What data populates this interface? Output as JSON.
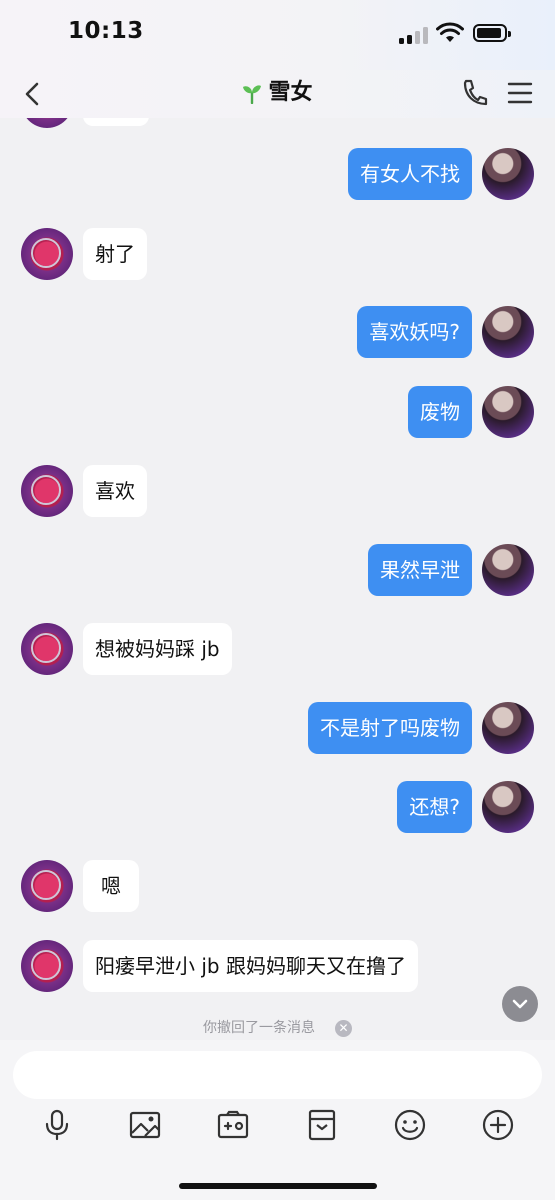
{
  "status_bar": {
    "time": "10:13"
  },
  "header": {
    "title": "雪女"
  },
  "messages": [
    {
      "side": "right",
      "text": "有女人不找"
    },
    {
      "side": "left",
      "text": "射了"
    },
    {
      "side": "right",
      "text": "喜欢妖吗?"
    },
    {
      "side": "right",
      "text": "废物"
    },
    {
      "side": "left",
      "text": "喜欢"
    },
    {
      "side": "right",
      "text": "果然早泄"
    },
    {
      "side": "left",
      "text": "想被妈妈踩 jb"
    },
    {
      "side": "right",
      "text": "不是射了吗废物"
    },
    {
      "side": "right",
      "text": "还想?"
    },
    {
      "side": "left",
      "text": "嗯"
    },
    {
      "side": "left",
      "text": "阳痿早泄小 jb 跟妈妈聊天又在撸了"
    }
  ],
  "recall_notice": "你撤回了一条消息",
  "input": {
    "placeholder": ""
  },
  "toolbar_icons": [
    "microphone-icon",
    "image-icon",
    "photo-add-icon",
    "file-icon",
    "emoji-icon",
    "plus-icon"
  ],
  "colors": {
    "bubble_sent": "#3e8ff2",
    "bubble_received": "#ffffff",
    "background": "#f1f1f3"
  }
}
